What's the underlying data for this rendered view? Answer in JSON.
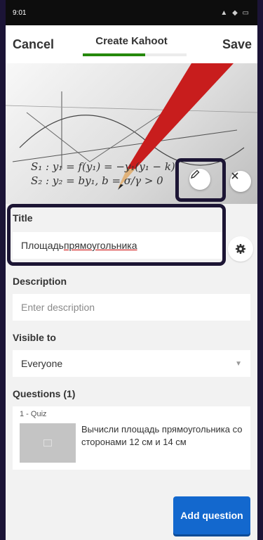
{
  "status_bar": {
    "time": "9:01",
    "indicators": "▲ ◆ ▭"
  },
  "header": {
    "cancel_label": "Cancel",
    "title": "Create Kahoot",
    "save_label": "Save",
    "progress": 0.6,
    "accent_color": "#26890c"
  },
  "cover": {
    "formula_line1": "S₁ : y₁ = f(y₁) = −y₁(y₁ − k)",
    "formula_line2": "S₂ : y₂ = by₁, b = σ/γ > 0",
    "edit_icon": "pencil-icon",
    "remove_icon": "close-icon"
  },
  "title_section": {
    "label": "Title",
    "value_part1": "Площадь ",
    "value_part2": "прямоугольника",
    "settings_icon": "gear-icon"
  },
  "description_section": {
    "label": "Description",
    "placeholder": "Enter description"
  },
  "visibility_section": {
    "label": "Visible to",
    "value": "Everyone"
  },
  "questions_section": {
    "label": "Questions (1)",
    "items": [
      {
        "type": "1 - Quiz",
        "text": "Вычисли площадь прямоугольника со сторонами 12 см и 14 см"
      }
    ]
  },
  "add_question": {
    "label": "Add question"
  },
  "colors": {
    "primary_button": "#1368ce",
    "background": "#f2f2f2",
    "annotation_border": "#1c1534"
  }
}
